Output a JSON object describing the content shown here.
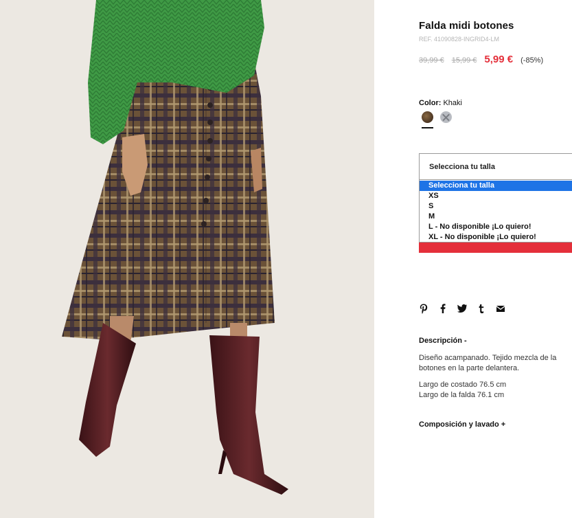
{
  "product": {
    "title": "Falda midi botones",
    "ref": "REF. 41090828-INGRID4-LM",
    "prices": {
      "original": "39,99 €",
      "previous": "15,99 €",
      "current": "5,99 €",
      "discount": "(-85%)"
    },
    "color": {
      "label": "Color:",
      "value": "Khaki",
      "swatches": [
        {
          "name": "khaki",
          "selected": true
        },
        {
          "name": "unavailable",
          "selected": false
        }
      ]
    },
    "size": {
      "placeholder": "Selecciona tu talla",
      "options": [
        "Selecciona tu talla",
        "XS",
        "S",
        "M",
        "L - No disponible ¡Lo quiero!",
        "XL - No disponible ¡Lo quiero!"
      ],
      "highlighted_index": 0
    },
    "share_icons": [
      "pinterest-icon",
      "facebook-icon",
      "twitter-icon",
      "tumblr-icon",
      "email-icon"
    ],
    "description": {
      "heading": "Descripción  -",
      "line1": "Diseño acampanado. Tejido mezcla de la",
      "line2": "botones en la parte delantera.",
      "line3": "Largo de costado 76.5 cm",
      "line4": "Largo de la falda 76.1 cm"
    },
    "composition": {
      "heading": "Composición y lavado  +"
    }
  },
  "colors": {
    "accent_red": "#e42f3a",
    "select_blue": "#1e74e6",
    "background": "#ece8e2"
  }
}
